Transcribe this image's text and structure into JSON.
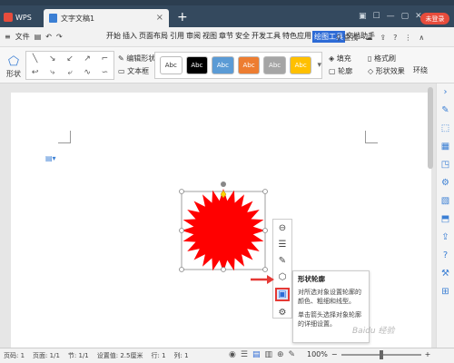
{
  "titlebar": {
    "app_tab": "WPS",
    "doc_tab": "文字文稿1",
    "new_tab": "+",
    "login": "未登录"
  },
  "menubar": {
    "file": "文件",
    "items": [
      "开始",
      "插入",
      "页面布局",
      "引用",
      "审阅",
      "视图",
      "章节",
      "安全",
      "开发工具",
      "特色应用",
      "绘图工具",
      "文档助手"
    ],
    "active": "绘图工具",
    "search": "查找"
  },
  "ribbon": {
    "shape_label": "形状",
    "edit_shape": "编辑形状",
    "textbox": "文本框",
    "styles": [
      {
        "label": "Abc",
        "bg": "#ffffff",
        "fg": "#333333"
      },
      {
        "label": "Abc",
        "bg": "#000000",
        "fg": "#ffffff"
      },
      {
        "label": "Abc",
        "bg": "#5b9bd5",
        "fg": "#ffffff"
      },
      {
        "label": "Abc",
        "bg": "#ed7d31",
        "fg": "#ffffff"
      },
      {
        "label": "Abc",
        "bg": "#a5a5a5",
        "fg": "#ffffff"
      },
      {
        "label": "Abc",
        "bg": "#ffc000",
        "fg": "#ffffff"
      }
    ],
    "fill": "填充",
    "format_painter": "格式刷",
    "outline": "轮廓",
    "shape_effects": "形状效果",
    "wrap": "环绕"
  },
  "tooltip": {
    "title": "形状轮廓",
    "desc1": "对所选对象设置轮廓的颜色、粗细和线型。",
    "desc2": "单击箭头选择对象轮廓的详细设置。"
  },
  "status": {
    "page_num": "页码: 1",
    "page": "页面: 1/1",
    "section": "节: 1/1",
    "setting": "设置值: 2.5厘米",
    "row": "行: 1",
    "col": "列: 1",
    "zoom": "100%"
  },
  "colors": {
    "shape_fill": "#ff0000",
    "accent": "#2d6bd6",
    "highlight": "#e53935"
  },
  "watermark": "Baidu 经验"
}
